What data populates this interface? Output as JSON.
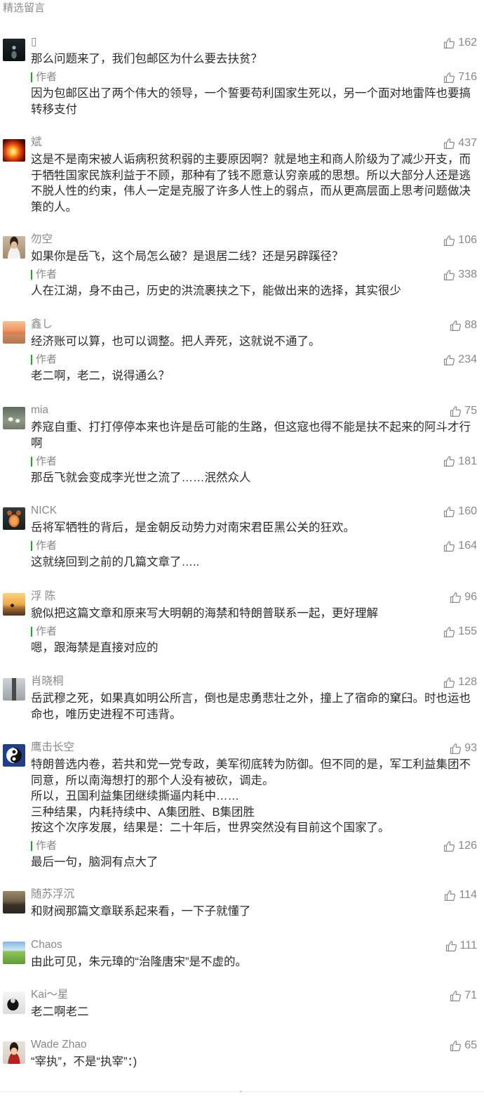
{
  "section_title": "精选留言",
  "author_label": "作者",
  "icons": {
    "like": "thumbs-up-icon"
  },
  "colors": {
    "author_bar": "#1aad19",
    "meta_text": "#888888",
    "body_text": "#2b2b2b"
  },
  "comments": [
    {
      "name": "▯",
      "likes": "162",
      "text": "那么问题来了，我们包邮区为什么要去扶贫？",
      "reply": {
        "likes": "716",
        "text": "因为包邮区出了两个伟大的领导，一个誓要苟利国家生死以，另一个面对地雷阵也要搞\n转移支付"
      }
    },
    {
      "name": "斌",
      "likes": "437",
      "text": "这是不是南宋被人诟病积贫积弱的主要原因啊？就是地主和商人阶级为了减少开支，而\n于牺牲国家民族利益于不顾，那种有了钱不愿意认穷亲戚的思想。所以大部分人还是逃\n不脱人性的约束，伟人一定是克服了许多人性上的弱点，而从更高层面上思考问题做决\n策的人。"
    },
    {
      "name": "勿空",
      "likes": "106",
      "text": "如果你是岳飞，这个局怎么破？是退居二线？还是另辟蹊径？",
      "reply": {
        "likes": "338",
        "text": "人在江湖，身不由己，历史的洪流裹挟之下，能做出来的选择，其实很少"
      }
    },
    {
      "name": "鑫し",
      "likes": "88",
      "text": "经济账可以算，也可以调整。把人弄死，这就说不通了。",
      "reply": {
        "likes": "234",
        "text": "老二啊，老二，说得通么？"
      }
    },
    {
      "name": "mia",
      "likes": "75",
      "text": "养寇自重、打打停停本来也许是岳可能的生路，但这寇也得不能是扶不起来的阿斗才行\n啊",
      "reply": {
        "likes": "181",
        "text": "那岳飞就会变成李光世之流了……泯然众人"
      }
    },
    {
      "name": "NICK",
      "likes": "160",
      "text": "岳将军牺牲的背后，是金朝反动势力对南宋君臣黑公关的狂欢。",
      "reply": {
        "likes": "164",
        "text": "这就绕回到之前的几篇文章了….."
      }
    },
    {
      "name": "浮 陈",
      "likes": "96",
      "text": "貌似把这篇文章和原来写大明朝的海禁和特朗普联系一起，更好理解",
      "reply": {
        "likes": "155",
        "text": "嗯，跟海禁是直接对应的"
      }
    },
    {
      "name": "肖晓桐",
      "likes": "128",
      "text": "岳武穆之死，如果真如明公所言，倒也是忠勇悲壮之外，撞上了宿命的窠臼。时也运也\n命也，唯历史进程不可违背。"
    },
    {
      "name": "鹰击长空",
      "likes": "93",
      "text": "特朗普选内卷，若共和党一党专政，美军彻底转为防御。但不同的是，军工利益集团不\n同意，所以南海想打的那个人没有被砍，调走。\n所以，丑国利益集团继续撕逼内耗中……\n三种结果，内耗持续中、A集团胜、B集团胜\n按这个次序发展，结果是：二十年后，世界突然没有目前这个国家了。",
      "reply": {
        "likes": "126",
        "text": "最后一句，脑洞有点大了"
      }
    },
    {
      "name": "随苏浮沉",
      "likes": "114",
      "text": "和财阀那篇文章联系起来看，一下子就懂了"
    },
    {
      "name": "Chaos",
      "likes": "111",
      "text": "由此可见，朱元璋的“治隆唐宋”是不虚的。"
    },
    {
      "name": "Kai～星",
      "likes": "71",
      "text": "老二啊老二"
    },
    {
      "name": "Wade Zhao",
      "likes": "65",
      "text": "“宰执”，不是“执宰”：)"
    }
  ]
}
